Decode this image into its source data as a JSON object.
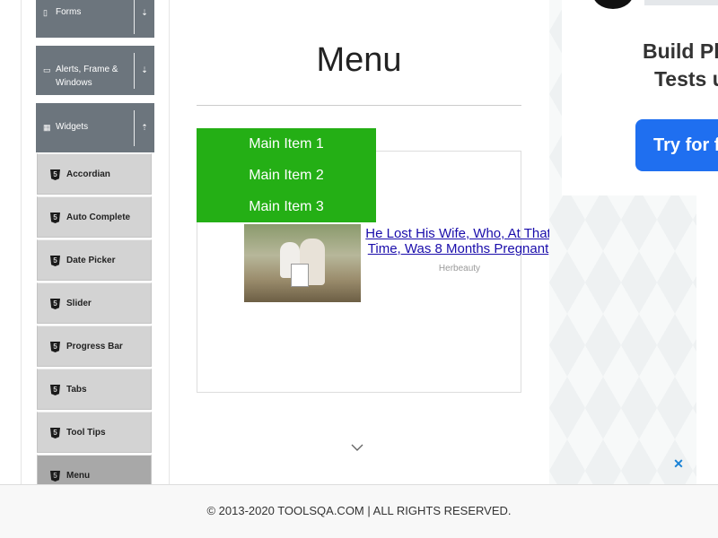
{
  "sidebar": {
    "groups": [
      {
        "label": "Forms",
        "icon": "document-icon",
        "arrow": "⇣"
      },
      {
        "label": "Alerts, Frame & Windows",
        "icon": "window-icon",
        "arrow": "⇣"
      },
      {
        "label": "Widgets",
        "icon": "grid-icon",
        "arrow": "⇡"
      }
    ],
    "items": [
      {
        "label": "Accordian"
      },
      {
        "label": "Auto Complete"
      },
      {
        "label": "Date Picker"
      },
      {
        "label": "Slider"
      },
      {
        "label": "Progress Bar"
      },
      {
        "label": "Tabs"
      },
      {
        "label": "Tool Tips"
      },
      {
        "label": "Menu",
        "active": true
      }
    ],
    "item_icon": "html5-icon"
  },
  "main": {
    "title": "Menu",
    "menu": [
      "Main Item 1",
      "Main Item 2",
      "Main Item 3"
    ],
    "menu_color": "#24af15"
  },
  "native_ad": {
    "headline": "He Lost His Wife, Who, At That Time, Was 8 Months Pregnant",
    "source": "Herbeauty",
    "cut_text": "Wh"
  },
  "right_ad": {
    "headline": "Build Playwr Tests usin",
    "button": "Try for fre",
    "close": "✕",
    "button_color": "#1f6ff0"
  },
  "footer": {
    "text": "© 2013-2020 TOOLSQA.COM | ALL RIGHTS RESERVED."
  }
}
